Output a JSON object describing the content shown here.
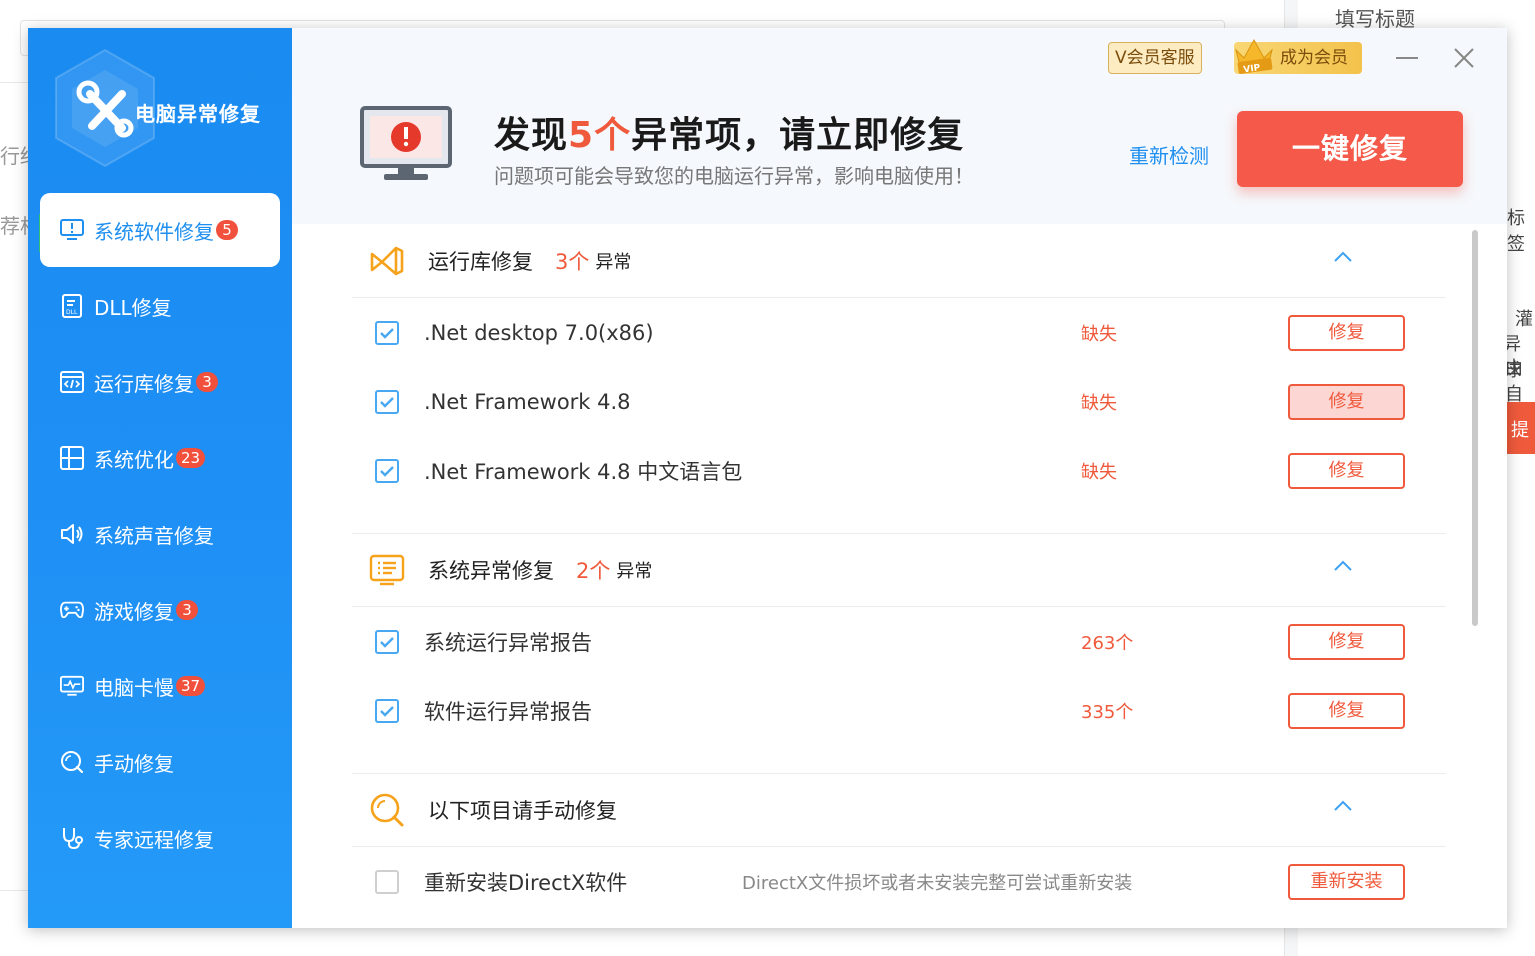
{
  "background": {
    "right_title": "填写标题",
    "left_fragments": [
      "行结",
      "荐相"
    ],
    "right_fragments": [
      "标签",
      "灌",
      "异球",
      "由自",
      "提"
    ]
  },
  "app": {
    "logo_text": "电脑异常修复",
    "sidebar": {
      "items": [
        {
          "label": "系统软件修复",
          "badge": "5",
          "icon": "monitor-alert-icon",
          "active": true
        },
        {
          "label": "DLL修复",
          "badge": "",
          "icon": "dll-file-icon"
        },
        {
          "label": "运行库修复",
          "badge": "3",
          "icon": "code-window-icon"
        },
        {
          "label": "系统优化",
          "badge": "23",
          "icon": "windows-icon"
        },
        {
          "label": "系统声音修复",
          "badge": "",
          "icon": "speaker-icon"
        },
        {
          "label": "游戏修复",
          "badge": "3",
          "icon": "gamepad-icon"
        },
        {
          "label": "电脑卡慢",
          "badge": "37",
          "icon": "performance-monitor-icon"
        },
        {
          "label": "手动修复",
          "badge": "",
          "icon": "search-icon"
        },
        {
          "label": "专家远程修复",
          "badge": "",
          "icon": "stethoscope-icon"
        }
      ]
    },
    "header": {
      "vip_service": "V会员客服",
      "become_vip": "成为会员",
      "vip_crown_text": "VIP",
      "headline_pre": "发现",
      "headline_num": "5个",
      "headline_post": "异常项，请立即修复",
      "subline": "问题项可能会导致您的电脑运行异常，影响电脑使用！",
      "recheck": "重新检测",
      "fix_all": "一键修复"
    },
    "sections": [
      {
        "title": "运行库修复",
        "count": "3个",
        "unit": "异常",
        "rows": [
          {
            "name": ".Net desktop 7.0(x86)",
            "status": "缺失",
            "button": "修复"
          },
          {
            "name": ".Net Framework 4.8",
            "status": "缺失",
            "button": "修复"
          },
          {
            "name": ".Net Framework 4.8 中文语言包",
            "status": "缺失",
            "button": "修复"
          }
        ]
      },
      {
        "title": "系统异常修复",
        "count": "2个",
        "unit": "异常",
        "rows": [
          {
            "name": "系统运行异常报告",
            "status": "263个",
            "button": "修复"
          },
          {
            "name": "软件运行异常报告",
            "status": "335个",
            "button": "修复"
          }
        ]
      },
      {
        "title": "以下项目请手动修复",
        "rows": [
          {
            "name": "重新安装DirectX软件",
            "desc": "DirectX文件损坏或者未安装完整可尝试重新安装",
            "button": "重新安装"
          }
        ]
      }
    ],
    "colors": {
      "accent": "#1f8ff0",
      "danger": "#f05a3c",
      "vip_gold": "#f3c24c"
    }
  }
}
